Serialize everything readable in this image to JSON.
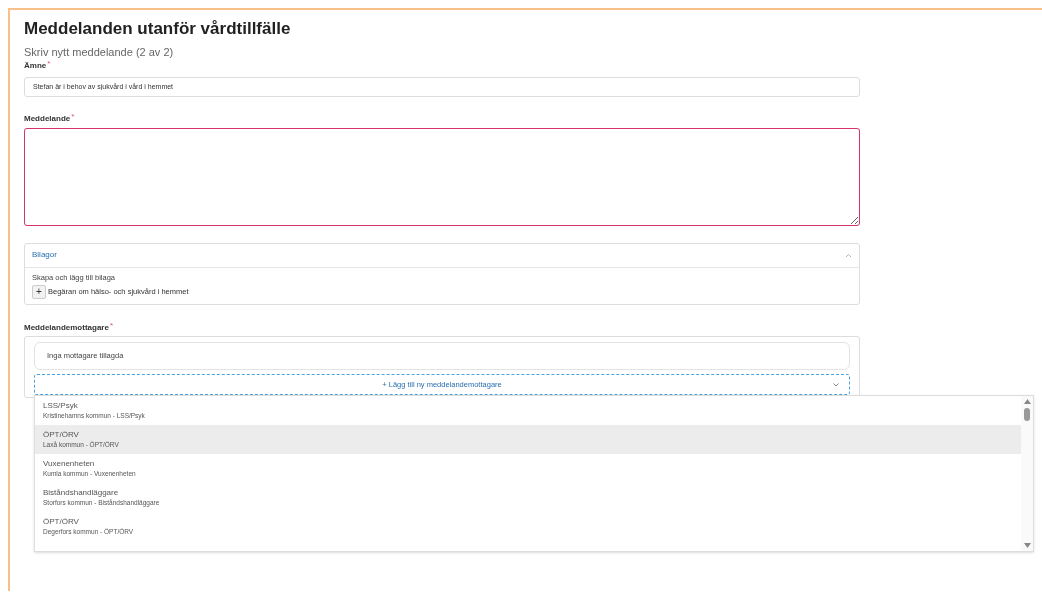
{
  "title": "Meddelanden utanför vårdtillfälle",
  "subtitle": "Skriv nytt meddelande (2 av 2)",
  "subject": {
    "label": "Ämne",
    "required_mark": "*",
    "value": "Stefan är i behov av sjukvård i vård i hemmet"
  },
  "message": {
    "label": "Meddelande",
    "required_mark": "*",
    "invalid": true
  },
  "attachments": {
    "title": "Bilagor",
    "expanded": true,
    "hint": "Skapa och lägg till bilaga",
    "items": [
      {
        "icon": "+",
        "label": "Begäran om hälso- och sjukvård i hemmet"
      }
    ]
  },
  "recipients": {
    "label": "Meddelandemottagare",
    "required_mark": "*",
    "empty_text": "Inga mottagare tillagda",
    "add_label": "+ Lägg till ny meddelandemottagare",
    "options": [
      {
        "title": "LSS/Psyk",
        "subtitle": "Kristinehamns kommun - LSS/Psyk",
        "selected": false
      },
      {
        "title": "ÖPT/ÖRV",
        "subtitle": "Laxå kommun - ÖPT/ÖRV",
        "selected": true
      },
      {
        "title": "Vuxenenheten",
        "subtitle": "Kumla kommun - Vuxenenheten",
        "selected": false
      },
      {
        "title": "Biståndshandläggare",
        "subtitle": "Storfors kommun - Biståndshandläggare",
        "selected": false
      },
      {
        "title": "ÖPT/ÖRV",
        "subtitle": "Degerfors kommun - ÖPT/ÖRV",
        "selected": false
      }
    ]
  }
}
